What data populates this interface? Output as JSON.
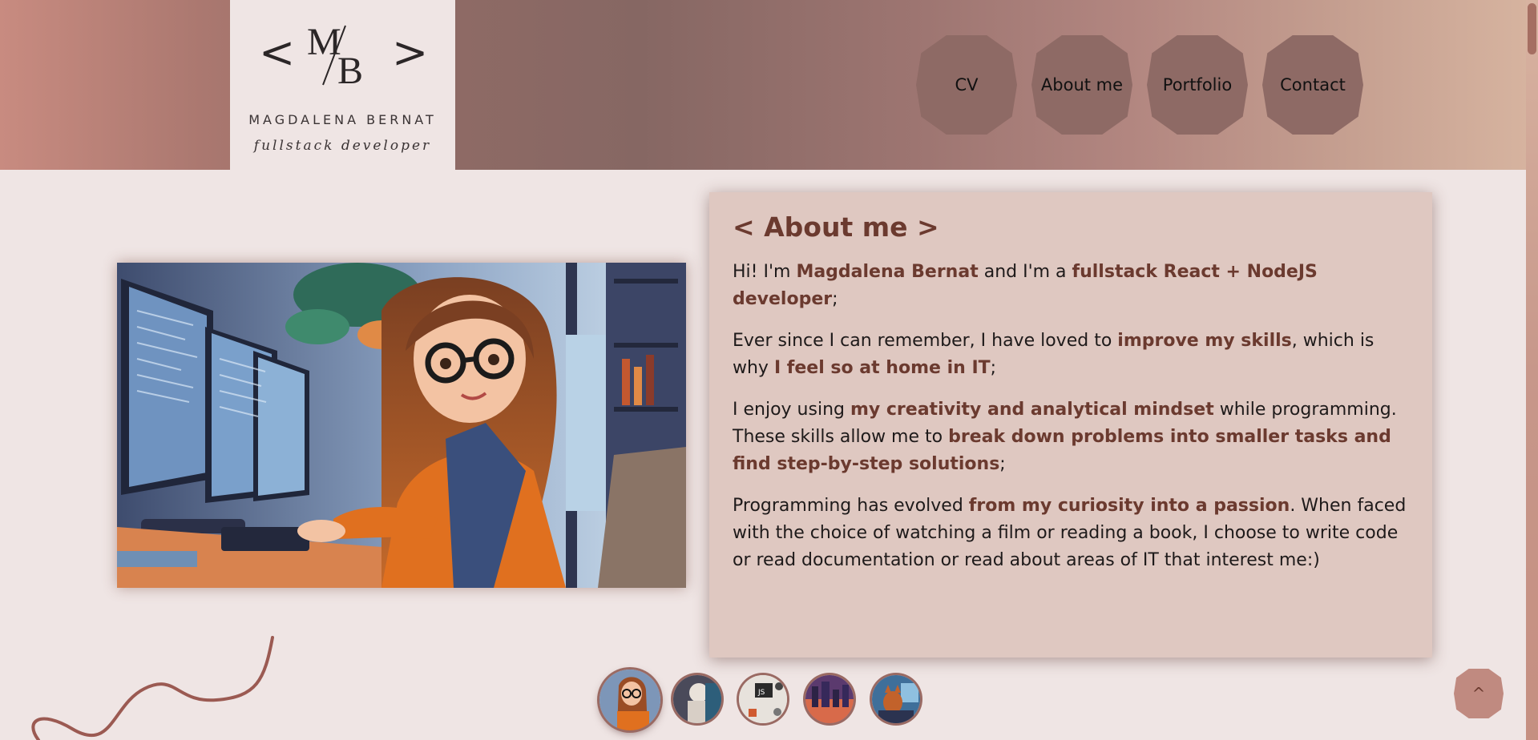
{
  "brand": {
    "monogram_left": "<",
    "monogram_right": ">",
    "monogram_letters": "M/B",
    "name": "MAGDALENA BERNAT",
    "tagline": "fullstack developer"
  },
  "nav": {
    "items": [
      {
        "label": "CV"
      },
      {
        "label": "About me"
      },
      {
        "label": "Portfolio"
      },
      {
        "label": "Contact"
      }
    ]
  },
  "about": {
    "title": "< About me >",
    "paragraphs": [
      [
        {
          "t": "Hi! I'm ",
          "b": false
        },
        {
          "t": "Magdalena Bernat",
          "b": true
        },
        {
          "t": " and I'm a ",
          "b": false
        },
        {
          "t": "fullstack React + NodeJS developer",
          "b": true
        },
        {
          "t": ";",
          "b": false
        }
      ],
      [
        {
          "t": "Ever since I can remember, I have loved to ",
          "b": false
        },
        {
          "t": "improve my skills",
          "b": true
        },
        {
          "t": ", which is why ",
          "b": false
        },
        {
          "t": "I feel so at home in IT",
          "b": true
        },
        {
          "t": ";",
          "b": false
        }
      ],
      [
        {
          "t": "I enjoy using ",
          "b": false
        },
        {
          "t": "my creativity and analytical mindset",
          "b": true
        },
        {
          "t": " while programming. These skills allow me to ",
          "b": false
        },
        {
          "t": "break down problems into smaller tasks and find step-by-step solutions",
          "b": true
        },
        {
          "t": ";",
          "b": false
        }
      ],
      [
        {
          "t": "Programming has evolved ",
          "b": false
        },
        {
          "t": "from my curiosity into a passion",
          "b": true
        },
        {
          "t": ". When faced with the choice of watching a film or reading a book, I choose to write code or read documentation or read about areas of IT that interest me:)",
          "b": false
        }
      ]
    ]
  },
  "gallery": {
    "items": [
      {
        "name": "thumb-developer-girl"
      },
      {
        "name": "thumb-astronaut"
      },
      {
        "name": "thumb-js-desk",
        "label": "JS"
      },
      {
        "name": "thumb-city-night"
      },
      {
        "name": "thumb-fox-computer"
      }
    ]
  },
  "back_to_top": {
    "label": "^"
  },
  "colors": {
    "accent": "#6b3a2f",
    "nav_button": "#8e6a65",
    "card_bg": "#dfc8c1",
    "page_bg": "#efe5e4"
  }
}
